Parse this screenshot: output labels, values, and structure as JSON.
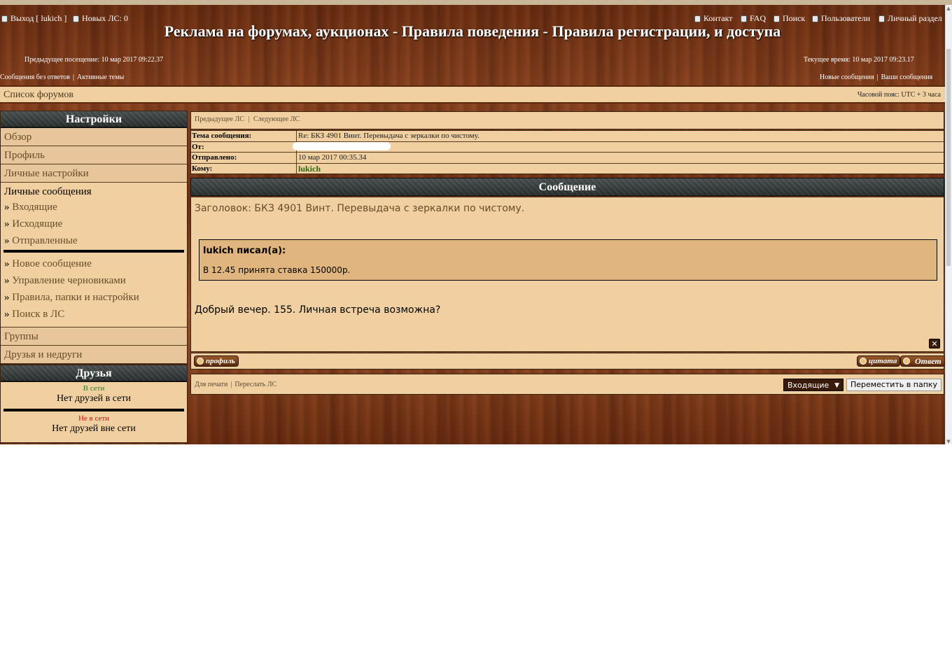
{
  "header": {
    "logout": "Выход [ lukich ]",
    "new_pm": "Новых ЛС: 0",
    "links": {
      "contact": "Контакт",
      "faq": "FAQ",
      "search": "Поиск",
      "users": "Пользователи",
      "personal": "Личный раздел"
    },
    "title": "Реклама на форумах, аукционах - Правила поведения - Правила регистрации, и доступа",
    "last_visit": "Предыдущее посещение: 10 мар 2017 09:22.37",
    "current_time": "Текущее время: 10 мар 2017 09:23.17",
    "unanswered": "Сообщения без ответов",
    "active": "Активные темы",
    "new_posts": "Новые сообщения",
    "your_posts": "Ваши сообщения",
    "sep": "|"
  },
  "navbar": {
    "forum_list": "Список форумов",
    "timezone": "Часовой пояс: UTC + 3 часа"
  },
  "sidebar": {
    "settings_title": "Настройки",
    "overview": "Обзор",
    "profile": "Профиль",
    "personal_settings": "Личные настройки",
    "pm_title": "Личные сообщения",
    "raquo": "»",
    "inbox": "Входящие",
    "outbox": "Исходящие",
    "sent": "Отправленные",
    "new_message": "Новое сообщение",
    "drafts": "Управление черновиками",
    "rules": "Правила, папки и настройки",
    "search_pm": "Поиск в ЛС",
    "groups": "Группы",
    "friends_foes": "Друзья и недруги"
  },
  "friends": {
    "title": "Друзья",
    "online_label": "В сети",
    "online_none": "Нет друзей в сети",
    "offline_label": "Не в сети",
    "offline_none": "Нет друзей вне сети",
    "online_color": "#2e7d1e",
    "offline_color": "#d01010"
  },
  "pm_nav": {
    "previous": "Предыдущее ЛС",
    "next": "Следующее ЛС",
    "sep": "|"
  },
  "message_meta": {
    "subject_label": "Тема сообщения:",
    "subject": "Re: БКЗ 4901 Винт. Перевыдача с зеркалки по чистому.",
    "from_label": "От:",
    "sent_label": "Отправлено:",
    "sent": "10 мар 2017 00:35.34",
    "to_label": "Кому:",
    "to": "lukich"
  },
  "message": {
    "heading": "Сообщение",
    "subject_line": "Заголовок: БКЗ 4901 Винт. Перевыдача с зеркалки по чистому.",
    "quote_author": "lukich писал(а):",
    "quote_text": "В 12.45 принята ставка 150000р.",
    "body": "Добрый вечер. 155. Личная встреча возможна?",
    "close_glyph": "✕"
  },
  "buttons": {
    "profile": "профиль",
    "quote": "цитата",
    "reply": "Ответ"
  },
  "bottom": {
    "print": "Для печати",
    "forward": "Переслать ЛС",
    "sep": "|",
    "folder": "Входящие",
    "folder_arrow": "▼",
    "move": "Переместить в папку"
  },
  "colors": {
    "panel": "#f0d0a0",
    "menu_item": "#e6c69a",
    "header_bar": "#2a3030",
    "link_text": "#6b4a2a"
  }
}
